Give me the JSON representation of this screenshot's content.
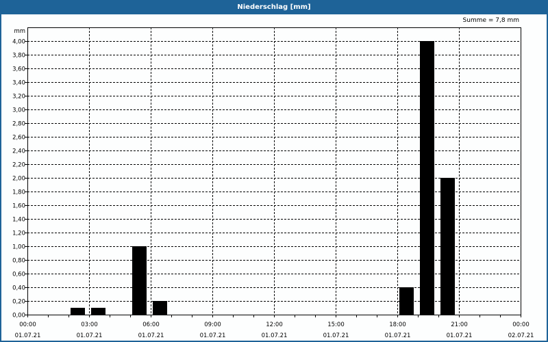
{
  "header": {
    "title": "Niederschlag [mm]"
  },
  "summary": "Summe = 7,8 mm",
  "chart_data": {
    "type": "bar",
    "title": "Niederschlag [mm]",
    "ylabel": "mm",
    "ylim": [
      0,
      4.0
    ],
    "yticks": [
      "0,00",
      "0,20",
      "0,40",
      "0,60",
      "0,80",
      "1,00",
      "1,20",
      "1,40",
      "1,60",
      "1,80",
      "2,00",
      "2,20",
      "2,40",
      "2,60",
      "2,80",
      "3,00",
      "3,20",
      "3,40",
      "3,60",
      "3,80",
      "4,00"
    ],
    "xlim_hours": [
      0,
      24
    ],
    "xticks": [
      {
        "time": "00:00",
        "date": "01.07.21",
        "hour": 0
      },
      {
        "time": "03:00",
        "date": "01.07.21",
        "hour": 3
      },
      {
        "time": "06:00",
        "date": "01.07.21",
        "hour": 6
      },
      {
        "time": "09:00",
        "date": "01.07.21",
        "hour": 9
      },
      {
        "time": "12:00",
        "date": "01.07.21",
        "hour": 12
      },
      {
        "time": "15:00",
        "date": "01.07.21",
        "hour": 15
      },
      {
        "time": "18:00",
        "date": "01.07.21",
        "hour": 18
      },
      {
        "time": "21:00",
        "date": "01.07.21",
        "hour": 21
      },
      {
        "time": "00:00",
        "date": "02.07.21",
        "hour": 24
      }
    ],
    "bars": [
      {
        "hour_start": 2,
        "value": 0.1
      },
      {
        "hour_start": 3,
        "value": 0.1
      },
      {
        "hour_start": 5,
        "value": 1.0
      },
      {
        "hour_start": 6,
        "value": 0.2
      },
      {
        "hour_start": 18,
        "value": 0.4
      },
      {
        "hour_start": 19,
        "value": 4.0
      },
      {
        "hour_start": 20,
        "value": 2.0
      }
    ],
    "grid": true,
    "colors": {
      "bar": "#000000",
      "header": "#1e6398"
    }
  }
}
